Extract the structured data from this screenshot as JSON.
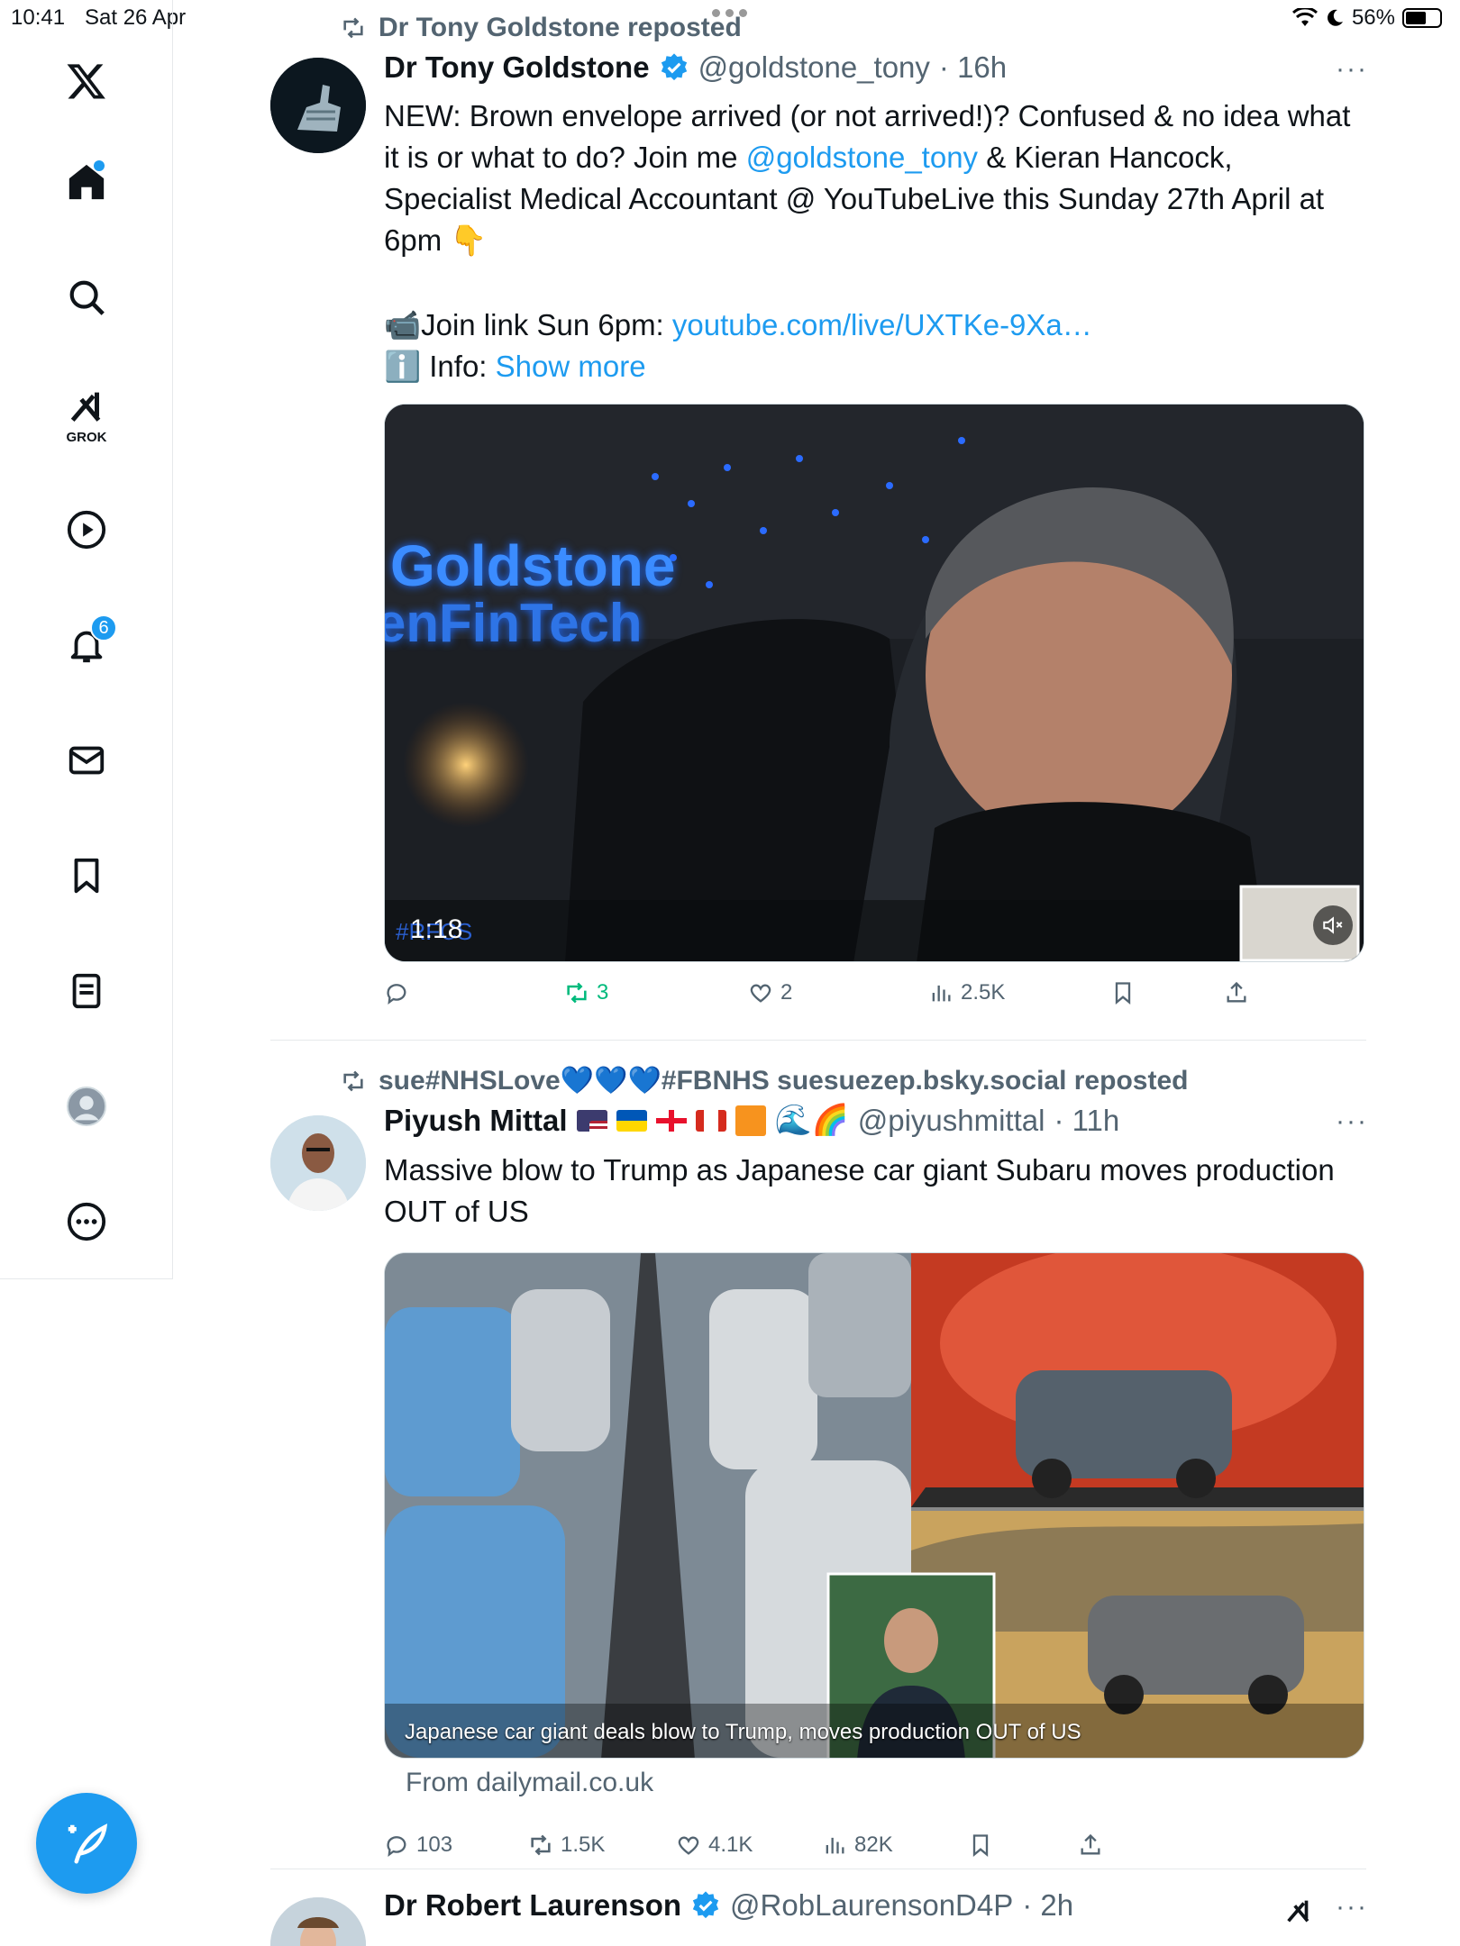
{
  "status_bar": {
    "time": "10:41",
    "date": "Sat 26 Apr",
    "battery": "56%"
  },
  "sidebar": {
    "items": [
      {
        "name": "home",
        "label": ""
      },
      {
        "name": "search",
        "label": ""
      },
      {
        "name": "grok",
        "label": "GROK"
      },
      {
        "name": "video",
        "label": ""
      },
      {
        "name": "notifications",
        "badge": "6"
      },
      {
        "name": "messages",
        "label": ""
      },
      {
        "name": "bookmarks",
        "label": ""
      },
      {
        "name": "lists",
        "label": ""
      },
      {
        "name": "profile",
        "label": ""
      },
      {
        "name": "more",
        "label": ""
      }
    ]
  },
  "tweets": [
    {
      "repost_by": "Dr Tony Goldstone reposted",
      "name": "Dr Tony Goldstone",
      "handle": "@goldstone_tony",
      "time": "· 16h",
      "text_1": "NEW: Brown envelope arrived (or not arrived!)? Confused & no idea what it is or what to do? Join me ",
      "mention": "@goldstone_tony",
      "text_2": " & Kieran Hancock, Specialist Medical Accountant @ YouTubeLive this Sunday 27th April at 6pm 👇",
      "join_prefix": "📹Join link Sun 6pm: ",
      "join_link": "youtube.com/live/UXTKe-9Xa…",
      "info_prefix": "ℹ️ Info: ",
      "show_more": "Show more",
      "video": {
        "duration": "1:18",
        "sign_line1": "Goldstone",
        "sign_line2": "enFinTech",
        "overlay_text": "#RFCS"
      },
      "stats": {
        "replies": "",
        "reposts": "3",
        "likes": "2",
        "views": "2.5K"
      }
    },
    {
      "repost_by": "sue#NHSLove💙💙💙#FBNHS suesuezep.bsky.social reposted",
      "name": "Piyush Mittal",
      "name_emojis": "🌊🌈",
      "handle": "@piyushmittal",
      "time": "· 11h",
      "text": "Massive blow to Trump as Japanese car giant Subaru moves production OUT of US",
      "card_caption": "Japanese car giant deals blow to Trump, moves production OUT of US",
      "card_source": "From dailymail.co.uk",
      "stats": {
        "replies": "103",
        "reposts": "1.5K",
        "likes": "4.1K",
        "views": "82K"
      }
    },
    {
      "name": "Dr Robert Laurenson",
      "handle": "@RobLaurensonD4P",
      "time": "· 2h"
    }
  ],
  "colors": {
    "accent": "#1d9bf0",
    "repost_green": "#00ba7c",
    "secondary_text": "#536471"
  }
}
